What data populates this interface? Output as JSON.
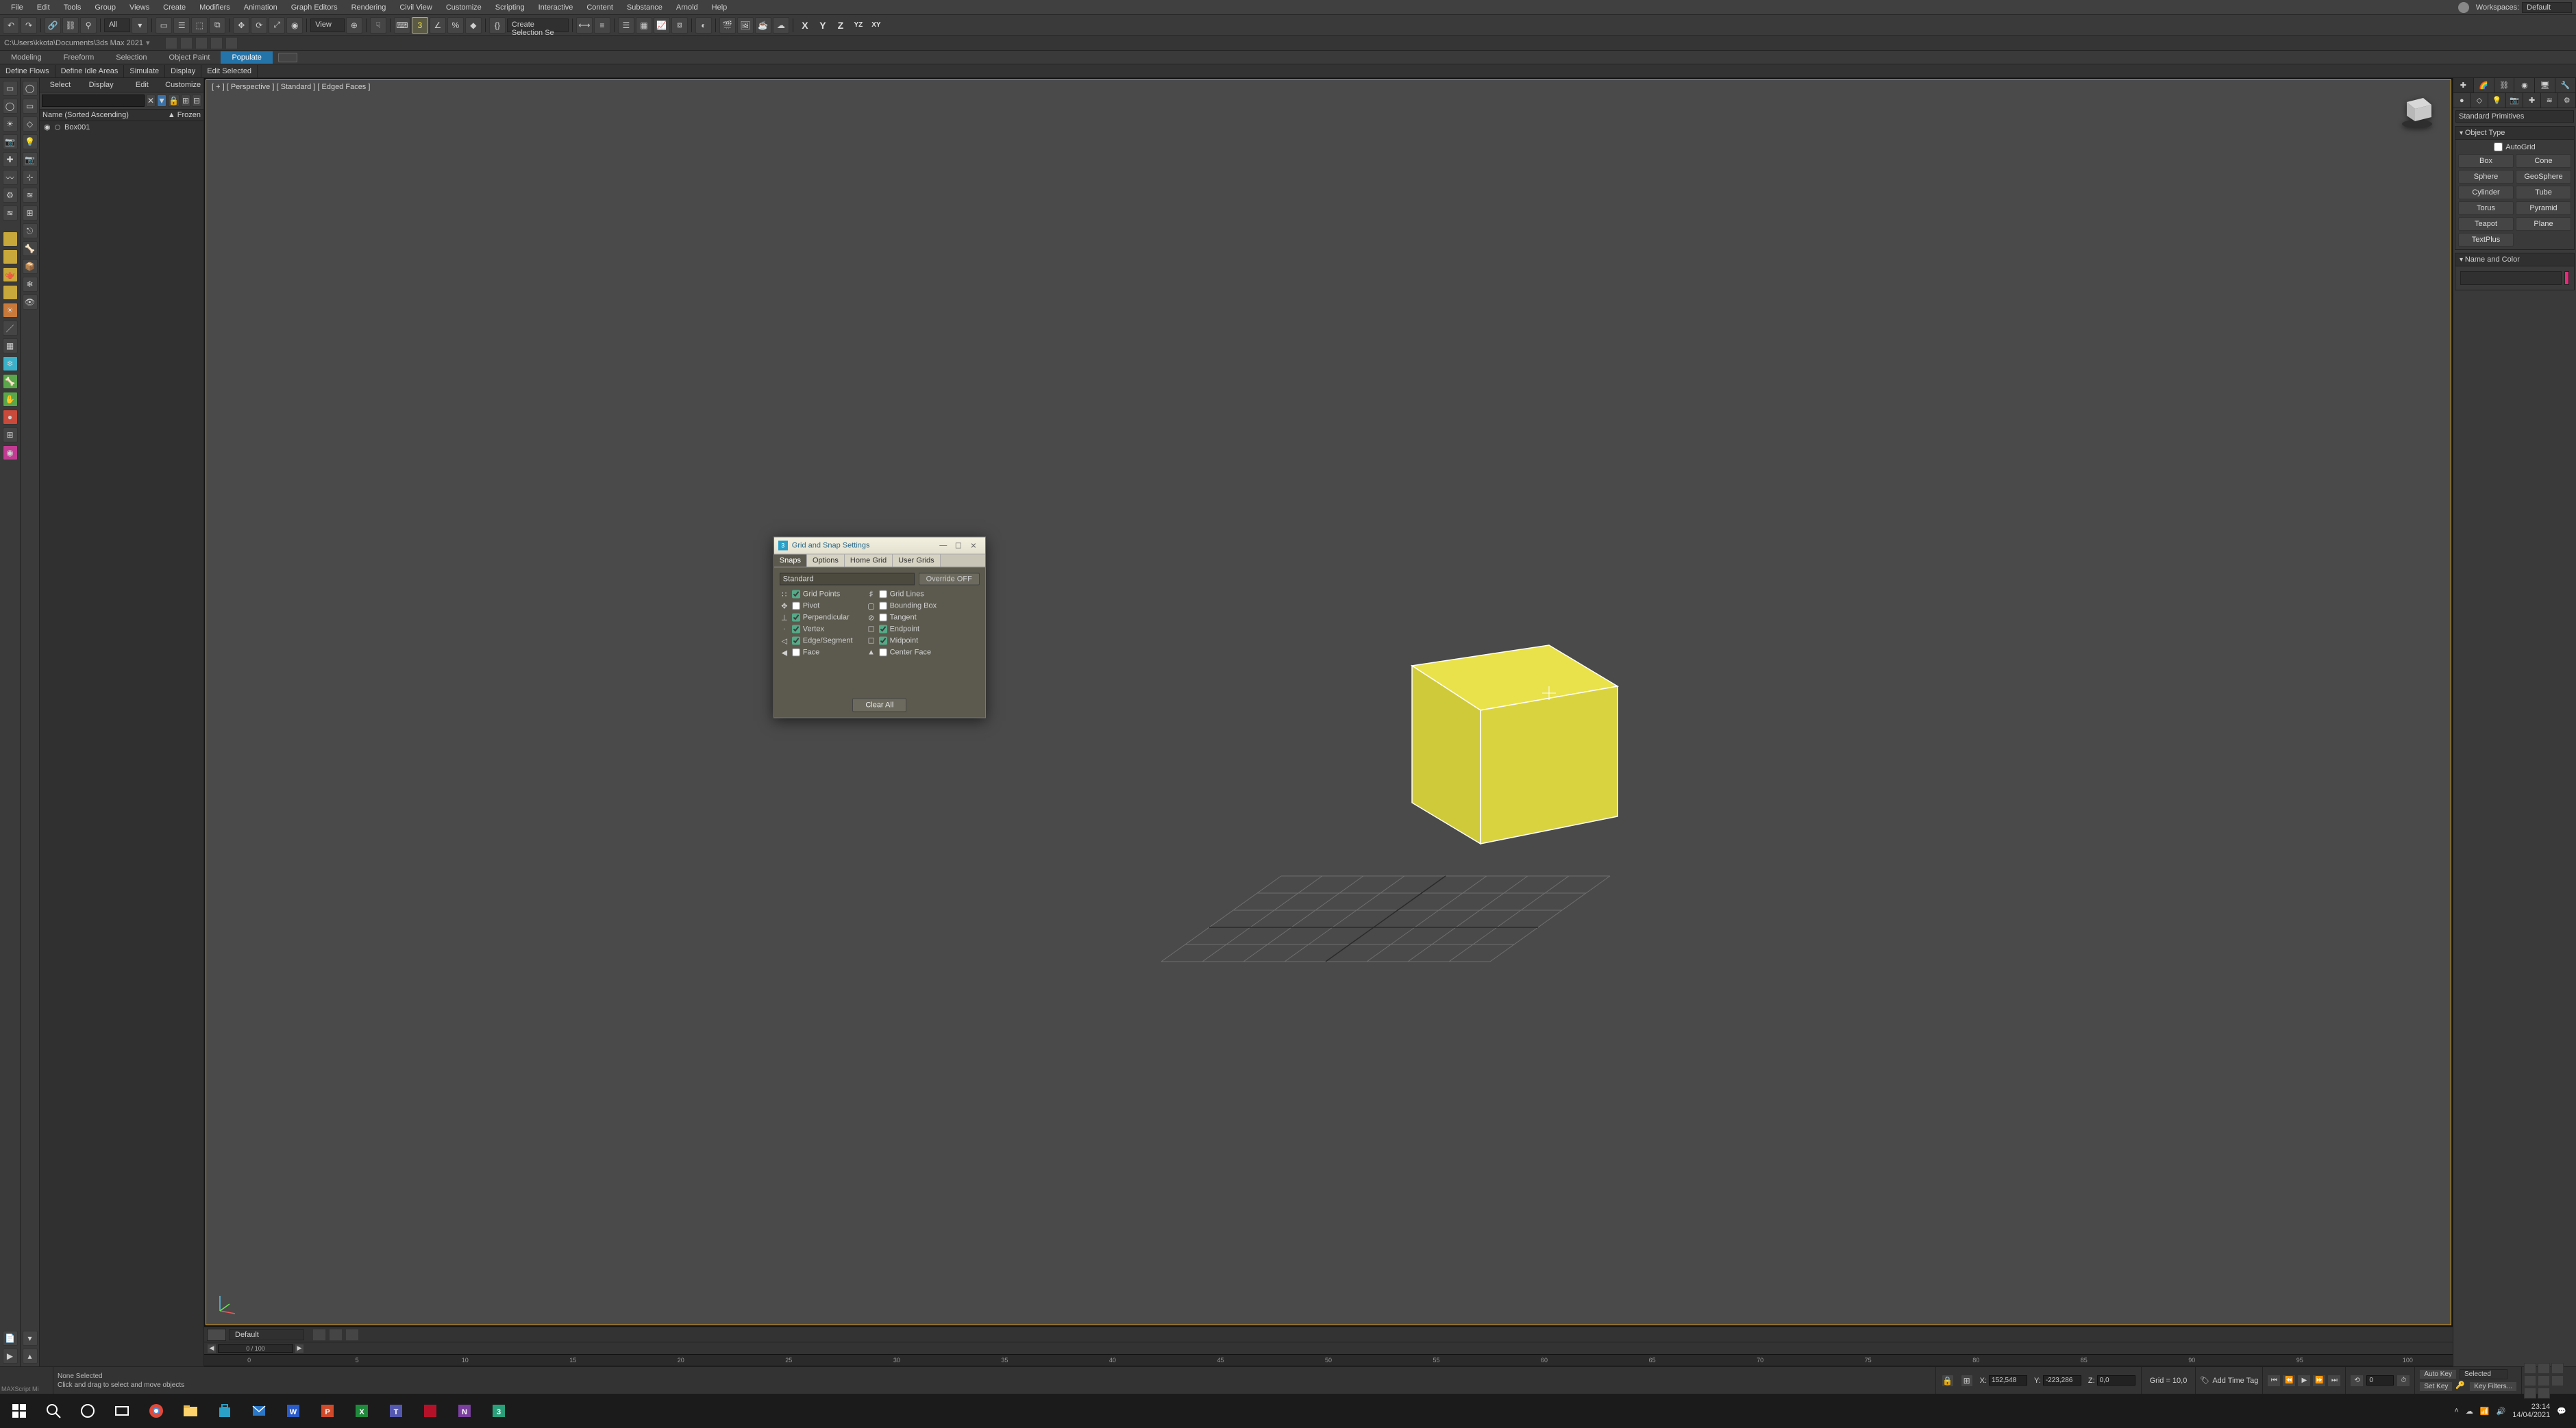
{
  "menubar": {
    "items": [
      "File",
      "Edit",
      "Tools",
      "Group",
      "Views",
      "Create",
      "Modifiers",
      "Animation",
      "Graph Editors",
      "Rendering",
      "Civil View",
      "Customize",
      "Scripting",
      "Interactive",
      "Content",
      "Substance",
      "Arnold",
      "Help"
    ],
    "workspace_label": "Workspaces:",
    "workspace_value": "Default"
  },
  "toolbar1": {
    "set_dd": "All",
    "view_dd": "View",
    "sel_dd": "Create Selection Se"
  },
  "axes": [
    "X",
    "Y",
    "Z",
    "YZ",
    "XY"
  ],
  "pathbar": {
    "path": "C:\\Users\\kkota\\Documents\\3ds Max 2021"
  },
  "ribbon": {
    "tabs": [
      "Modeling",
      "Freeform",
      "Selection",
      "Object Paint",
      "Populate"
    ]
  },
  "subribbon": {
    "btns": [
      "Define Flows",
      "Define Idle Areas",
      "Simulate",
      "Display",
      "Edit Selected"
    ]
  },
  "scene_explorer": {
    "tabs": [
      "Select",
      "Display",
      "Edit",
      "Customize"
    ],
    "col1": "Name (Sorted Ascending)",
    "col2": "▲ Frozen",
    "rows": [
      {
        "name": "Box001"
      }
    ]
  },
  "viewport": {
    "label": "[ + ] [ Perspective ] [ Standard ] [ Edged Faces ]"
  },
  "dialog": {
    "title": "Grid and Snap Settings",
    "tabs": [
      "Snaps",
      "Options",
      "Home Grid",
      "User Grids"
    ],
    "active_tab": 0,
    "mode_dd": "Standard",
    "override": "Override OFF",
    "left": [
      {
        "label": "Grid Points",
        "checked": true
      },
      {
        "label": "Pivot",
        "checked": false
      },
      {
        "label": "Perpendicular",
        "checked": true
      },
      {
        "label": "Vertex",
        "checked": true
      },
      {
        "label": "Edge/Segment",
        "checked": true
      },
      {
        "label": "Face",
        "checked": false
      }
    ],
    "right": [
      {
        "label": "Grid Lines",
        "checked": false
      },
      {
        "label": "Bounding Box",
        "checked": false
      },
      {
        "label": "Tangent",
        "checked": false
      },
      {
        "label": "Endpoint",
        "checked": true
      },
      {
        "label": "Midpoint",
        "checked": true
      },
      {
        "label": "Center Face",
        "checked": false
      }
    ],
    "clear": "Clear All"
  },
  "command_panel": {
    "category": "Standard Primitives",
    "rollout1": "Object Type",
    "autogrid": "AutoGrid",
    "primitives": [
      "Box",
      "Cone",
      "Sphere",
      "GeoSphere",
      "Cylinder",
      "Tube",
      "Torus",
      "Pyramid",
      "Teapot",
      "Plane",
      "TextPlus",
      ""
    ],
    "rollout2": "Name and Color",
    "name_value": ""
  },
  "vpfooter": {
    "layer": "Default"
  },
  "timeline": {
    "frame_label": "0 / 100",
    "ticks": [
      0,
      5,
      10,
      15,
      20,
      25,
      30,
      35,
      40,
      45,
      50,
      55,
      60,
      65,
      70,
      75,
      80,
      85,
      90,
      95,
      100
    ]
  },
  "status": {
    "script": "MAXScript Mi",
    "line1": "None Selected",
    "line2": "Click and drag to select and move objects",
    "X_label": "X:",
    "Y_label": "Y:",
    "Z_label": "Z:",
    "X": "152,548",
    "Y": "-223,286",
    "Z": "0,0",
    "grid": "Grid = 10,0",
    "add_time_tag": "Add Time Tag",
    "auto_key": "Auto Key",
    "set_key": "Set Key",
    "selected": "Selected",
    "key_filters": "Key Filters...",
    "spinner": "0"
  },
  "systray": {
    "time": "23:14",
    "date": "14/04/2021"
  }
}
